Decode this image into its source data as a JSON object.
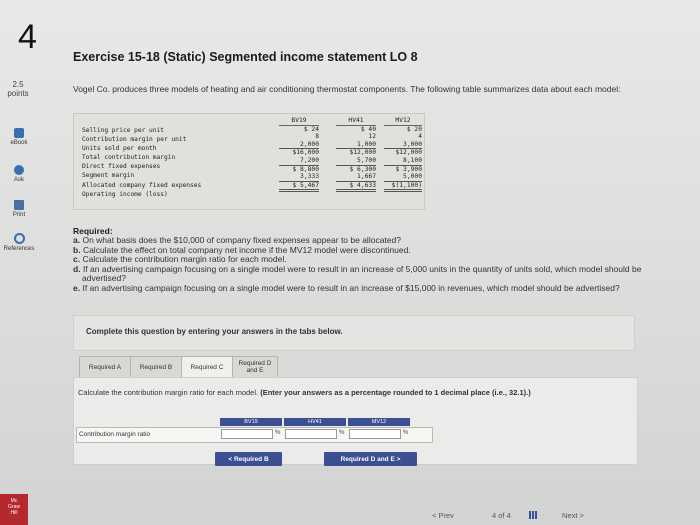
{
  "question_number": "4",
  "exercise_title": "Exercise 15-18 (Static) Segmented income statement LO 8",
  "points": {
    "value": "2.5",
    "label": "points"
  },
  "side_rail": [
    {
      "label": "eBook",
      "icon": "book-icon"
    },
    {
      "label": "Ask",
      "icon": "chat-icon"
    },
    {
      "label": "Print",
      "icon": "print-icon"
    },
    {
      "label": "References",
      "icon": "references-icon"
    }
  ],
  "intro": "Vogel Co. produces three models of heating and air conditioning thermostat components. The following table summarizes data about each model:",
  "table": {
    "row_labels": [
      "Selling price per unit",
      "Contribution margin per unit",
      "Units sold per month",
      "Total contribution margin",
      "Direct fixed expenses",
      "Segment margin",
      "Allocated company fixed expenses",
      "Operating income (loss)"
    ],
    "columns": [
      {
        "header": "BV19",
        "values": [
          "$    24",
          "8",
          "2,000",
          "$16,000",
          "7,200",
          "$ 8,800",
          "3,333",
          "$ 5,467"
        ]
      },
      {
        "header": "HV41",
        "values": [
          "$    40",
          "12",
          "1,000",
          "$12,000",
          "5,700",
          "$ 6,300",
          "1,667",
          "$ 4,633"
        ]
      },
      {
        "header": "MV12",
        "values": [
          "$    20",
          "4",
          "3,000",
          "$12,000",
          "8,100",
          "$ 3,900",
          "5,000",
          "$(1,100)"
        ]
      }
    ]
  },
  "required_heading": "Required:",
  "required_items": [
    {
      "letter": "a.",
      "text": "On what basis does the $10,000 of company fixed expenses appear to be allocated?"
    },
    {
      "letter": "b.",
      "text": "Calculate the effect on total company net income if the MV12 model were discontinued."
    },
    {
      "letter": "c.",
      "text": "Calculate the contribution margin ratio for each model."
    },
    {
      "letter": "d.",
      "text": "If an advertising campaign focusing on a single model were to result in an increase of 5,000 units in the quantity of units sold, which model should be advertised?"
    },
    {
      "letter": "e.",
      "text": "If an advertising campaign focusing on a single model were to result in an increase of $15,000 in revenues, which model should be advertised?"
    }
  ],
  "instruction": "Complete this question by entering your answers in the tabs below.",
  "tabs": [
    {
      "label": "Required A"
    },
    {
      "label": "Required B"
    },
    {
      "label": "Required C"
    },
    {
      "label": "Required D and E"
    }
  ],
  "calc_text": "Calculate the contribution margin ratio for each model.",
  "calc_note": "(Enter your answers as a percentage rounded to 1 decimal place (i.e., 32.1).)",
  "answer": {
    "headers": [
      "BV19",
      "HV41",
      "MV12"
    ],
    "row_label": "Contribution margin ratio",
    "values": [
      "",
      "",
      ""
    ],
    "unit": "%"
  },
  "buttons": {
    "prev": "< Required B",
    "next": "Required D and E >"
  },
  "footer": {
    "prev": "< Prev",
    "page": "4 of 4",
    "next": "Next >"
  }
}
